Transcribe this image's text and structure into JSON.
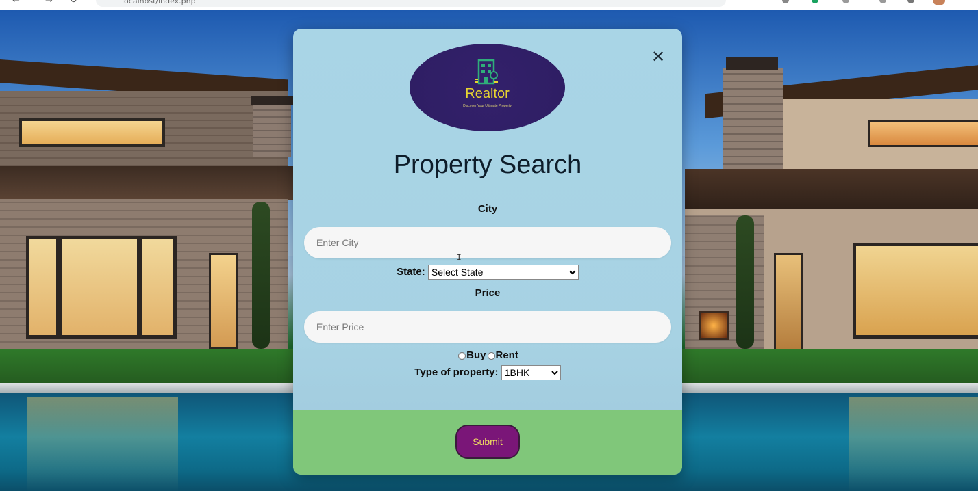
{
  "browser": {
    "url": "localhost/index.php"
  },
  "form": {
    "logo_text": "Realtor",
    "logo_tagline": "Discover Your Ultimate Property",
    "title": "Property Search",
    "city_label": "City",
    "city_placeholder": "Enter City",
    "state_label": "State:",
    "state_selected": "Select State",
    "price_label": "Price",
    "price_placeholder": "Enter Price",
    "option_buy": "Buy",
    "option_rent": "Rent",
    "property_type_label": "Type of property:",
    "property_type_selected": "1BHK",
    "submit_label": "Submit",
    "close_symbol": "✕"
  },
  "colors": {
    "card_bg": "#a9d5e6",
    "footer_bg": "#80c77a",
    "submit_bg": "#7a1678",
    "submit_text": "#f2e061",
    "logo_bg": "#2e1e63",
    "logo_text": "#e6d431"
  }
}
